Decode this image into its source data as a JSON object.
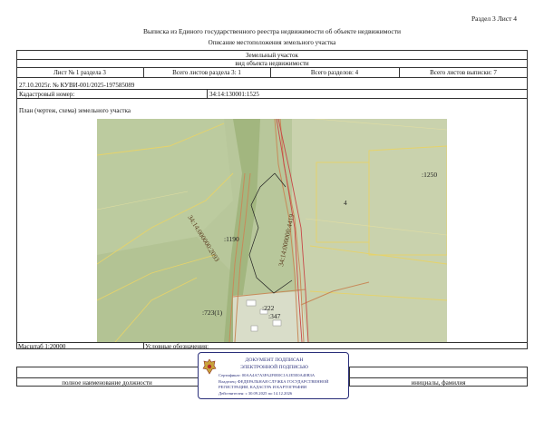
{
  "header": {
    "section_sheet": "Раздел 3   Лист 4",
    "title": "Выписка из Единого государственного реестра недвижимости об объекте недвижимости",
    "subtitle": "Описание местоположения земельного участка"
  },
  "object": {
    "type": "Земельный участок",
    "kind_label": "вид объекта недвижимости"
  },
  "sheet_row": {
    "sheet_of_section": "Лист № 1 раздела 3",
    "total_sheets_section": "Всего листов раздела 3: 1",
    "total_sections": "Всего разделов: 4",
    "total_sheets_extract": "Всего листов выписки: 7"
  },
  "doc": {
    "date_number": "27.10.2025г. № КУВИ-001/2025-197585089",
    "cadastral_label": "Кадастровый номер:",
    "cadastral_number": "34:14:130001:1525"
  },
  "plan": {
    "label": "План (чертеж, схема) земельного участка",
    "map_labels": {
      "parcel_1250": ":1250",
      "parcel_4": "4",
      "parcel_1190": ":1190",
      "road_left": "34:14:000000:2093",
      "road_right": "34:14:000000:4419",
      "parcel_723": ":723(1)",
      "parcel_222": ":222",
      "parcel_347": ":347"
    }
  },
  "footer": {
    "scale": "Масштаб 1:20000",
    "legend_label": "Условные обозначения:",
    "position_label": "полное наименование должности",
    "name_label": "инициалы, фамилия"
  },
  "stamp": {
    "title": "ДОКУМЕНТ ПОДПИСАН",
    "subtitle": "ЭЛЕКТРОННОЙ ПОДПИСЬЮ",
    "certificate": "Сертификат: 00AA4A7A3FA2F0E0C1A1E5E0A40B3A",
    "owner": "Владелец: ФЕДЕРАЛЬНАЯ СЛУЖБА ГОСУДАРСТВЕННОЙ",
    "owner2": "РЕГИСТРАЦИИ, КАДАСТРА И КАРТОГРАФИИ",
    "valid": "Действителен: с 30.09.2025 по 14.12.2026"
  }
}
